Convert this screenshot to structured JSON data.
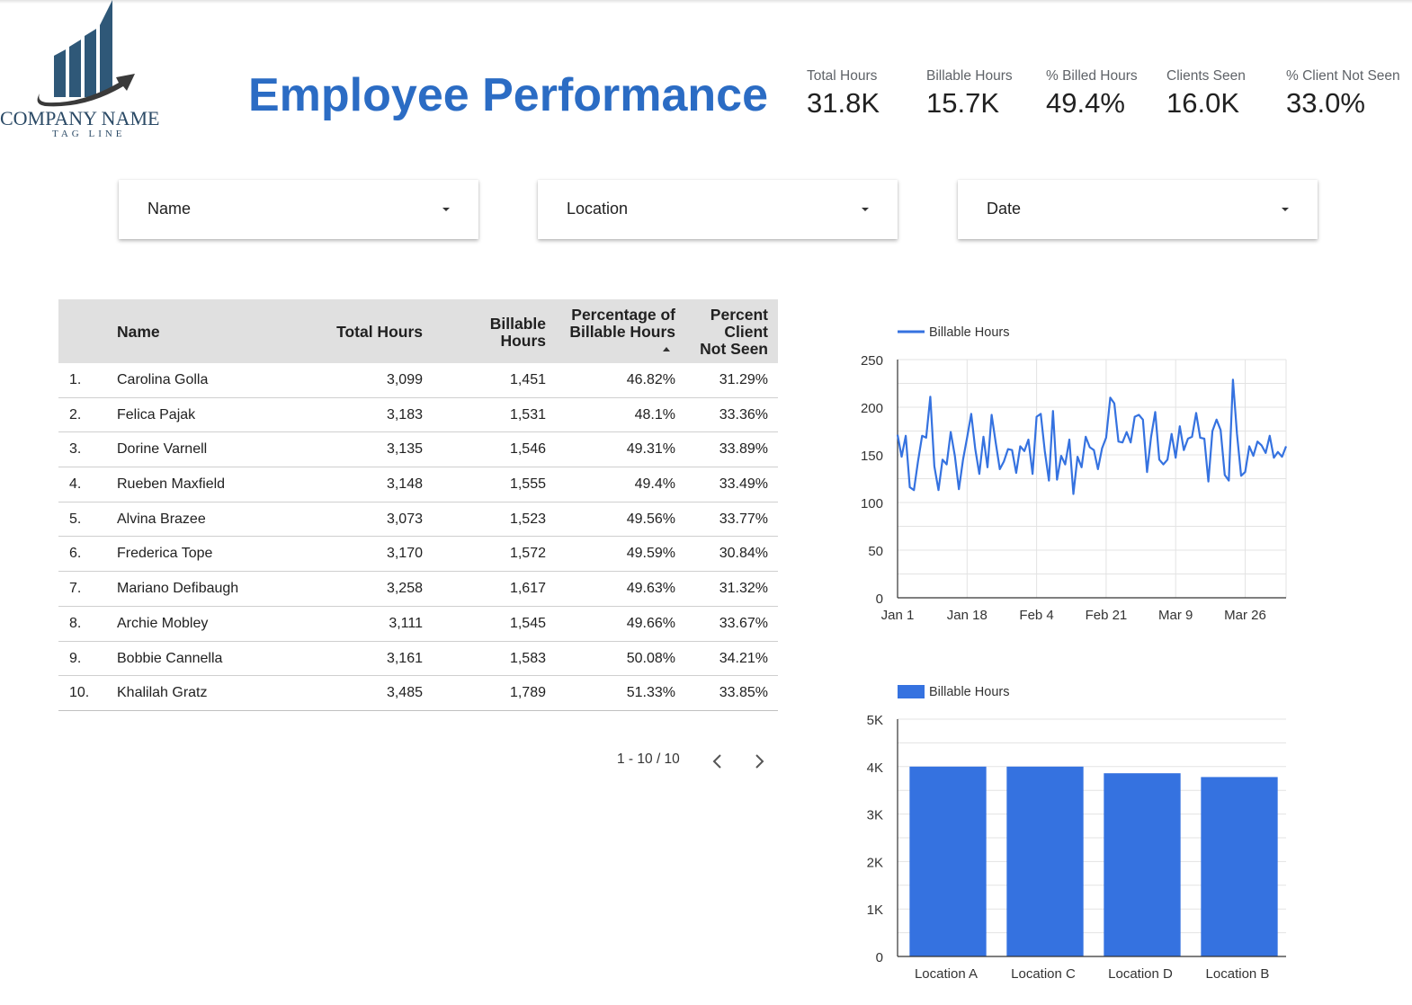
{
  "brand": {
    "company_name": "COMPANY NAME",
    "tagline": "TAG LINE",
    "logo_icon": "bar-chart-arrow-logo"
  },
  "page_title": "Employee Performance",
  "kpis": [
    {
      "label": "Total Hours",
      "value": "31.8K"
    },
    {
      "label": "Billable Hours",
      "value": "15.7K"
    },
    {
      "label": "% Billed Hours",
      "value": "49.4%"
    },
    {
      "label": "Clients Seen",
      "value": "16.0K"
    },
    {
      "label": "% Client Not Seen",
      "value": "33.0%"
    }
  ],
  "filters": [
    {
      "label": "Name",
      "icon": "dropdown-arrow-icon"
    },
    {
      "label": "Location",
      "icon": "dropdown-arrow-icon"
    },
    {
      "label": "Date",
      "icon": "dropdown-arrow-icon"
    }
  ],
  "table": {
    "headers": {
      "name": "Name",
      "total_hours": "Total Hours",
      "billable_1": "Billable",
      "billable_2": "Hours",
      "pct_1": "Percentage of",
      "pct_2": "Billable Hours",
      "not_seen_1": "Percent",
      "not_seen_2": "Client",
      "not_seen_3": "Not Seen"
    },
    "sorted_column": "Percentage of Billable Hours",
    "sort_direction": "ascending",
    "rows": [
      {
        "idx": "1.",
        "name": "Carolina Golla",
        "total": "3,099",
        "billable": "1,451",
        "pct": "46.82%",
        "not_seen": "31.29%"
      },
      {
        "idx": "2.",
        "name": "Felica Pajak",
        "total": "3,183",
        "billable": "1,531",
        "pct": "48.1%",
        "not_seen": "33.36%"
      },
      {
        "idx": "3.",
        "name": "Dorine Varnell",
        "total": "3,135",
        "billable": "1,546",
        "pct": "49.31%",
        "not_seen": "33.89%"
      },
      {
        "idx": "4.",
        "name": "Rueben Maxfield",
        "total": "3,148",
        "billable": "1,555",
        "pct": "49.4%",
        "not_seen": "33.49%"
      },
      {
        "idx": "5.",
        "name": "Alvina Brazee",
        "total": "3,073",
        "billable": "1,523",
        "pct": "49.56%",
        "not_seen": "33.77%"
      },
      {
        "idx": "6.",
        "name": "Frederica Tope",
        "total": "3,170",
        "billable": "1,572",
        "pct": "49.59%",
        "not_seen": "30.84%"
      },
      {
        "idx": "7.",
        "name": "Mariano Defibaugh",
        "total": "3,258",
        "billable": "1,617",
        "pct": "49.63%",
        "not_seen": "31.32%"
      },
      {
        "idx": "8.",
        "name": "Archie Mobley",
        "total": "3,111",
        "billable": "1,545",
        "pct": "49.66%",
        "not_seen": "33.67%"
      },
      {
        "idx": "9.",
        "name": "Bobbie Cannella",
        "total": "3,161",
        "billable": "1,583",
        "pct": "50.08%",
        "not_seen": "34.21%"
      },
      {
        "idx": "10.",
        "name": "Khalilah Gratz",
        "total": "3,485",
        "billable": "1,789",
        "pct": "51.33%",
        "not_seen": "33.85%"
      }
    ],
    "pagination": {
      "text": "1 - 10 / 10",
      "prev_icon": "chevron-left-icon",
      "next_icon": "chevron-right-icon"
    }
  },
  "colors": {
    "accent": "#2b6cc4",
    "series": "#3572e0",
    "header_bg": "#e0e0e0",
    "logo": "#2f5878"
  },
  "chart_data": [
    {
      "type": "line",
      "legend": [
        "Billable Hours"
      ],
      "legend_position": "top-left",
      "x_tick_labels": [
        "Jan 1",
        "Jan 18",
        "Feb 4",
        "Feb 21",
        "Mar 9",
        "Mar 26"
      ],
      "y_ticks": [
        0,
        50,
        100,
        150,
        200,
        250
      ],
      "ylim": [
        0,
        250
      ],
      "grid": true,
      "x_start": "2019-01-01",
      "x_end": "2019-04-06",
      "series": [
        {
          "name": "Billable Hours",
          "x": [
            "2019-01-01",
            "2019-01-02",
            "2019-01-03",
            "2019-01-04",
            "2019-01-05",
            "2019-01-06",
            "2019-01-07",
            "2019-01-08",
            "2019-01-09",
            "2019-01-10",
            "2019-01-11",
            "2019-01-12",
            "2019-01-13",
            "2019-01-14",
            "2019-01-15",
            "2019-01-16",
            "2019-01-17",
            "2019-01-18",
            "2019-01-19",
            "2019-01-20",
            "2019-01-21",
            "2019-01-22",
            "2019-01-23",
            "2019-01-24",
            "2019-01-25",
            "2019-01-26",
            "2019-01-27",
            "2019-01-28",
            "2019-01-29",
            "2019-01-30",
            "2019-01-31",
            "2019-02-01",
            "2019-02-02",
            "2019-02-03",
            "2019-02-04",
            "2019-02-05",
            "2019-02-06",
            "2019-02-07",
            "2019-02-08",
            "2019-02-09",
            "2019-02-10",
            "2019-02-11",
            "2019-02-12",
            "2019-02-13",
            "2019-02-14",
            "2019-02-15",
            "2019-02-16",
            "2019-02-17",
            "2019-02-18",
            "2019-02-19",
            "2019-02-20",
            "2019-02-21",
            "2019-02-22",
            "2019-02-23",
            "2019-02-24",
            "2019-02-25",
            "2019-02-26",
            "2019-02-27",
            "2019-02-28",
            "2019-03-01",
            "2019-03-02",
            "2019-03-03",
            "2019-03-04",
            "2019-03-05",
            "2019-03-06",
            "2019-03-07",
            "2019-03-08",
            "2019-03-09",
            "2019-03-10",
            "2019-03-11",
            "2019-03-12",
            "2019-03-13",
            "2019-03-14",
            "2019-03-15",
            "2019-03-16",
            "2019-03-17",
            "2019-03-18",
            "2019-03-19",
            "2019-03-20",
            "2019-03-21",
            "2019-03-22",
            "2019-03-23",
            "2019-03-24",
            "2019-03-25",
            "2019-03-26",
            "2019-03-27",
            "2019-03-28",
            "2019-03-29",
            "2019-03-30",
            "2019-03-31",
            "2019-04-01",
            "2019-04-02",
            "2019-04-03",
            "2019-04-04",
            "2019-04-05",
            "2019-04-06"
          ],
          "values": [
            171,
            148,
            170,
            116,
            113,
            143,
            170,
            168,
            211,
            138,
            113,
            145,
            140,
            174,
            149,
            114,
            145,
            168,
            193,
            156,
            130,
            169,
            137,
            192,
            163,
            135,
            143,
            156,
            155,
            131,
            159,
            154,
            166,
            130,
            190,
            193,
            154,
            123,
            196,
            124,
            149,
            140,
            166,
            109,
            148,
            137,
            169,
            158,
            155,
            135,
            157,
            168,
            210,
            204,
            164,
            163,
            174,
            163,
            190,
            192,
            187,
            132,
            169,
            195,
            145,
            140,
            145,
            172,
            147,
            180,
            155,
            167,
            169,
            194,
            168,
            167,
            122,
            175,
            187,
            176,
            129,
            123,
            229,
            172,
            128,
            132,
            159,
            149,
            164,
            160,
            152,
            170,
            147,
            153,
            148,
            159
          ]
        }
      ]
    },
    {
      "type": "bar",
      "legend": [
        "Billable Hours"
      ],
      "legend_position": "top-left",
      "categories": [
        "Location A",
        "Location C",
        "Location D",
        "Location B"
      ],
      "values": [
        4000,
        4000,
        3860,
        3780
      ],
      "y_tick_labels": [
        "0",
        "1K",
        "2K",
        "3K",
        "4K",
        "5K"
      ],
      "ylim": [
        0,
        5000
      ],
      "grid": true
    }
  ]
}
